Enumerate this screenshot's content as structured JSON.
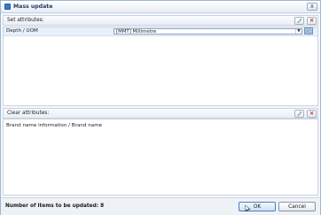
{
  "window": {
    "title": "Mass update",
    "close_glyph": "x"
  },
  "set_section": {
    "label": "Set attributes:",
    "attribute": {
      "name": "Depth / UOM",
      "value": "[MMT] Millimetre"
    }
  },
  "clear_section": {
    "label": "Clear attributes:",
    "items": [
      "Brand name information / Brand name"
    ]
  },
  "footer": {
    "count_label": "Number of items to be updated: 8",
    "ok_label": "OK",
    "cancel_label": "Cancel"
  },
  "icons": {
    "app": "mass-update-icon",
    "add": "add-attribute-icon",
    "remove": "remove-icon",
    "dropdown": "chevron-down-icon",
    "lookup": "lookup-icon"
  }
}
